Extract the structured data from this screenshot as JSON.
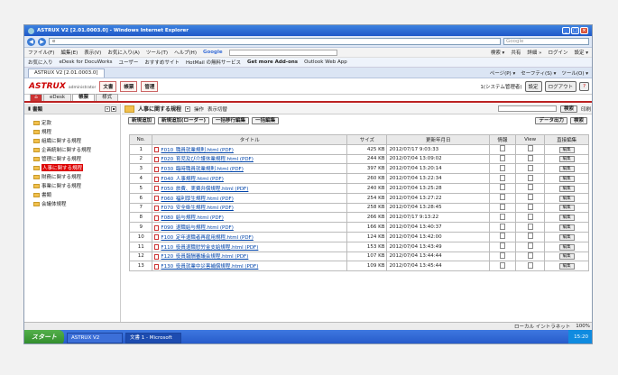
{
  "window": {
    "title": "ASTRUX V2 [2.01.0003.0] - Windows Internet Explorer"
  },
  "browser": {
    "address": "e",
    "search_placeholder": "Google",
    "menu": [
      "ファイル(F)",
      "編集(E)",
      "表示(V)",
      "お気に入り(A)",
      "ツール(T)",
      "ヘルプ(H)"
    ],
    "google_label": "Google",
    "menu_right": [
      "検索 ▾",
      "共有",
      "詳細 »",
      "ログイン",
      "設定 ▾"
    ],
    "favorites": [
      "お気に入り",
      "eDesk for DocuWorks",
      "ユーザー",
      "おすすめサイト",
      "HotMail の無料サービス",
      "Get more Add-ons",
      "Outlook Web App"
    ],
    "tab": "ASTRUX V2 [2.01.0003.0]",
    "tab_tools": [
      "ページ(P) ▾",
      "セーフティ(S) ▾",
      "ツール(O) ▾"
    ]
  },
  "app": {
    "logo": "ASTRUX",
    "logo_sub": "administrator",
    "modules": [
      "文書",
      "帳票",
      "管理"
    ],
    "user": "1(システム管理者)",
    "settings": "設定",
    "logout": "ログアウト",
    "help": "?",
    "tabs": [
      "eDesk",
      "帳票",
      "様式"
    ]
  },
  "left": {
    "title": "書類",
    "tree": [
      "定款",
      "規程",
      "組織に関する規程",
      "企画統制に関する規程",
      "管理に関する規程",
      "人事に関する規程",
      "財務に関する規程",
      "事業に関する規程",
      "書類",
      "会議体規程"
    ]
  },
  "main": {
    "title": "人事に関する規程",
    "op": "操作",
    "view": "表示切替",
    "search": "検索",
    "print": "印刷",
    "buttons": [
      "新規追加",
      "新規追加(ローダー)",
      "一括移行編集",
      "一括編集"
    ],
    "export": "データ出力",
    "search2": "検索",
    "headers": [
      "No.",
      "タイトル",
      "サイズ",
      "更新年月日",
      "情報",
      "View",
      "直接編集"
    ],
    "rows": [
      [
        "1",
        "F010_職員就業規則.html (PDF)",
        "425 KB",
        "2012/07/17 9:03:33",
        "編集"
      ],
      [
        "2",
        "F020_育児及び介護休業規程.html (PDF)",
        "244 KB",
        "2012/07/04 13:09:02",
        "編集"
      ],
      [
        "3",
        "F030_臨時職員就業規則.html (PDF)",
        "397 KB",
        "2012/07/04 13:20:14",
        "編集"
      ],
      [
        "4",
        "F040_人事規程.html (PDF)",
        "260 KB",
        "2012/07/04 13:22:34",
        "編集"
      ],
      [
        "5",
        "F050_旅費、実費弁償規程.html (PDF)",
        "240 KB",
        "2012/07/04 13:25:28",
        "編集"
      ],
      [
        "6",
        "F060_福利厚生規程.html (PDF)",
        "254 KB",
        "2012/07/04 13:27:22",
        "編集"
      ],
      [
        "7",
        "F070_安全衛生規程.html (PDF)",
        "258 KB",
        "2012/07/04 13:28:45",
        "編集"
      ],
      [
        "8",
        "F080_給与規程.html (PDF)",
        "266 KB",
        "2012/07/17 9:13:22",
        "編集"
      ],
      [
        "9",
        "F090_退職給与規程.html (PDF)",
        "166 KB",
        "2012/07/04 13:40:37",
        "編集"
      ],
      [
        "10",
        "F100_定年退職者再雇用規程.html (PDF)",
        "124 KB",
        "2012/07/04 13:42:00",
        "編集"
      ],
      [
        "11",
        "F110_役員退職慰労金支給規程.html (PDF)",
        "153 KB",
        "2012/07/04 13:43:49",
        "編集"
      ],
      [
        "12",
        "F120_役員報酬審議会規程.html (PDF)",
        "107 KB",
        "2012/07/04 13:44:44",
        "編集"
      ],
      [
        "13",
        "F130_役員就業中災害補償規程.html (PDF)",
        "109 KB",
        "2012/07/04 13:45:44",
        "編集"
      ]
    ]
  },
  "status": {
    "zone": "ローカル イントラネット",
    "zoom": "100%"
  },
  "taskbar": {
    "start": "スタート",
    "tasks": [
      "ASTRUX V2 [2.01.00...",
      "文書 1 - Microsoft W..."
    ],
    "clock": "15:20"
  }
}
